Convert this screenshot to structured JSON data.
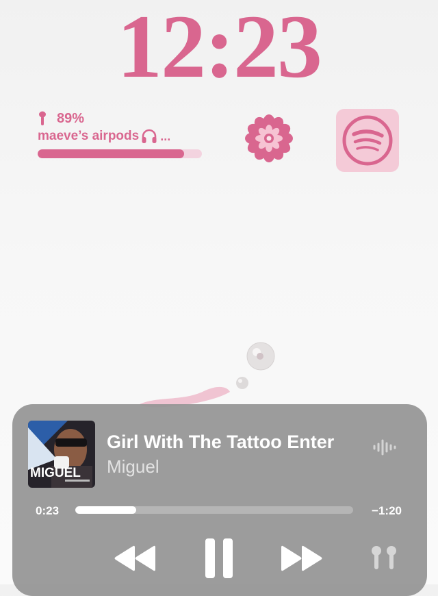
{
  "lock_screen": {
    "time": "12:23"
  },
  "battery_widget": {
    "percent": "89%",
    "device_name": "maeve’s airpods",
    "device_more": "...",
    "level": 0.89,
    "accent_color": "#d9668f"
  },
  "widgets": {
    "flower_icon": "flower-icon",
    "spotify_icon": "spotify-icon"
  },
  "now_playing": {
    "album_art_text": "MIGUEL",
    "title": "Girl With The Tattoo Enter",
    "artist": "Miguel",
    "elapsed": "0:23",
    "remaining": "−1:20",
    "progress": 0.22,
    "controls": [
      "rewind",
      "pause",
      "fast-forward",
      "airpods-output"
    ]
  }
}
